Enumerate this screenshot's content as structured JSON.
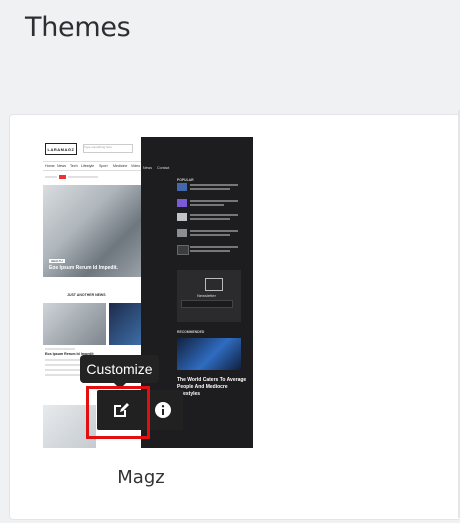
{
  "page": {
    "title": "Themes"
  },
  "theme": {
    "name": "Magz",
    "preview": {
      "logo": "LARAMAGZ",
      "nav": [
        "Home",
        "News",
        "Tech",
        "Lifestyle",
        "Sport",
        "Medicine",
        "Video",
        "News",
        "Contact"
      ],
      "hero_tag": "HEALTH",
      "hero_title": "Eos Ipsum Rerum Id Impedit.",
      "section_title": "JUST ANOTHER NEWS",
      "card_title": "Eos Ipsum Rerum Id Impedit",
      "right_section": "POPULAR",
      "newsletter_title": "Newsletter",
      "recommended": "RECOMMENDED",
      "feature_title": "The World Caters To Average People And Mediocre Lifestyles",
      "search_placeholder": "Type something here"
    }
  },
  "tooltip": {
    "text": "Customize"
  },
  "actions": [
    {
      "name": "customize",
      "icon": "edit-icon"
    },
    {
      "name": "info",
      "icon": "info-icon"
    }
  ],
  "colors": {
    "highlight": "#e10f0f",
    "overlay": "#212121",
    "background": "#f0f1f3"
  }
}
